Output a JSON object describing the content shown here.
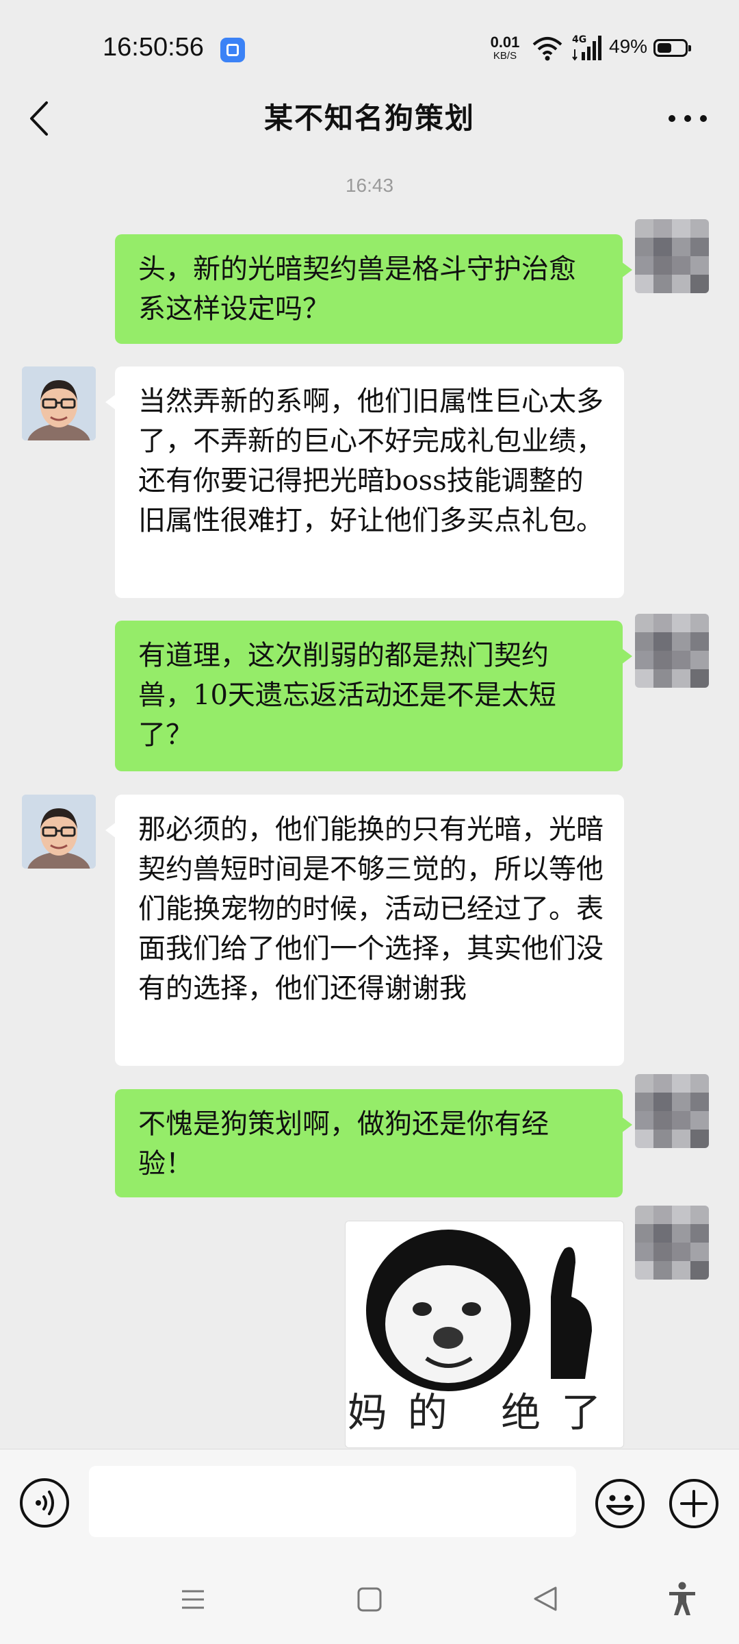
{
  "status_bar": {
    "time": "16:50:56",
    "net_speed_value": "0.01",
    "net_speed_unit": "KB/S",
    "network_type": "4G",
    "battery_percent": "49%"
  },
  "header": {
    "title": "某不知名狗策划",
    "back_icon": "chevron-left-icon",
    "more_icon": "more-dots-icon"
  },
  "chat": {
    "timestamp": "16:43",
    "messages": [
      {
        "from": "me",
        "text": "头，新的光暗契约兽是格斗守护治愈系这样设定吗？"
      },
      {
        "from": "other",
        "text": "当然弄新的系啊，他们旧属性巨心太多了，不弄新的巨心不好完成礼包业绩，还有你要记得把光暗boss技能调整的旧属性很难打，好让他们多买点礼包。"
      },
      {
        "from": "me",
        "text": "有道理，这次削弱的都是热门契约兽，10天遗忘返活动还是不是太短了？"
      },
      {
        "from": "other",
        "text": "那必须的，他们能换的只有光暗，光暗契约兽短时间是不够三觉的，所以等他们能换宠物的时候，活动已经过了。表面我们给了他们一个选择，其实他们没有的选择，他们还得谢谢我"
      },
      {
        "from": "me",
        "text": "不愧是狗策划啊，做狗还是你有经验！"
      }
    ],
    "sticker_caption": "妈的 绝了"
  },
  "input_bar": {
    "voice_icon": "voice-icon",
    "placeholder": "",
    "emoji_icon": "emoji-icon",
    "plus_icon": "plus-icon"
  },
  "nav_bar": {
    "menu_icon": "menu-icon",
    "home_icon": "home-icon",
    "back_icon": "back-triangle-icon",
    "accessibility_icon": "accessibility-icon"
  },
  "colors": {
    "background": "#ededed",
    "my_bubble": "#95ec69",
    "other_bubble": "#ffffff"
  }
}
